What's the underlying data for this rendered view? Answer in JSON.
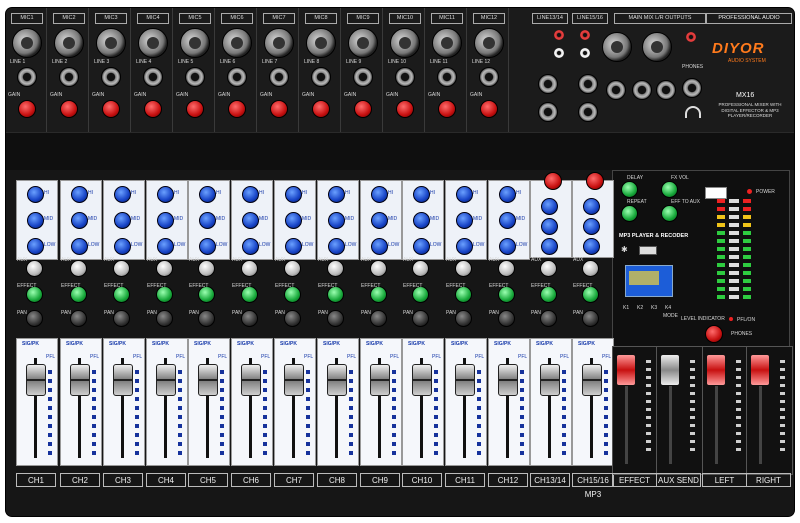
{
  "inputs": {
    "mics": [
      "MIC1",
      "MIC2",
      "MIC3",
      "MIC4",
      "MIC5",
      "MIC6",
      "MIC7",
      "MIC8",
      "MIC9",
      "MIC10",
      "MIC11",
      "MIC12"
    ],
    "line_labels": [
      "LINE 1",
      "LINE 2",
      "LINE 3",
      "LINE 4",
      "LINE 5",
      "LINE 6",
      "LINE 7",
      "LINE 8",
      "LINE 9",
      "LINE 10",
      "LINE 11",
      "LINE 12"
    ],
    "gain_label": "GAIN",
    "stereo_in_1": "LINE13/14",
    "stereo_in_2": "LINE15/16",
    "main_outputs": "MAIN MIX L/R OUTPUTS",
    "phones": "PHONES"
  },
  "brand": {
    "header": "PROFESSIONAL AUDIO",
    "name": "DIYOR",
    "tagline": "AUDIO SYSTEM",
    "model": "MX16",
    "desc": "PROFESSIONAL MIXER WITH DIGITAL EFFECTOR & MP3 PLAYER/RECORDER"
  },
  "channels": [
    "CH1",
    "CH2",
    "CH3",
    "CH4",
    "CH5",
    "CH6",
    "CH7",
    "CH8",
    "CH9",
    "CH10",
    "CH11",
    "CH12",
    "CH13/14",
    "CH15/16 MP3"
  ],
  "eq": {
    "hi": "HI",
    "mid": "MID",
    "low": "LOW"
  },
  "sends": {
    "aux": "AUX",
    "effect": "EFFECT",
    "pan": "PAN"
  },
  "fader": {
    "sig": "SIG/PK",
    "pfl": "PFL"
  },
  "mp3": {
    "title": "MP3 PLAYER & RECODER",
    "delay": "DELAY",
    "fx_vol": "FX VOL",
    "repeat": "REPEAT",
    "eff_to_aux": "EFF TO AUX",
    "power": "POWER",
    "keys": [
      "K1",
      "K2",
      "K3",
      "K4"
    ],
    "mode": "MODE",
    "level": "LEVEL INDICATOR",
    "pfl": "PFL/ON",
    "phones": "PHONES"
  },
  "masters": [
    "EFFECT",
    "AUX SEND",
    "LEFT",
    "RIGHT"
  ],
  "colors": {
    "accent_blue": "#1743c6",
    "knob_red": "#c71010",
    "knob_green": "#17a83a",
    "panel": "#141414"
  }
}
